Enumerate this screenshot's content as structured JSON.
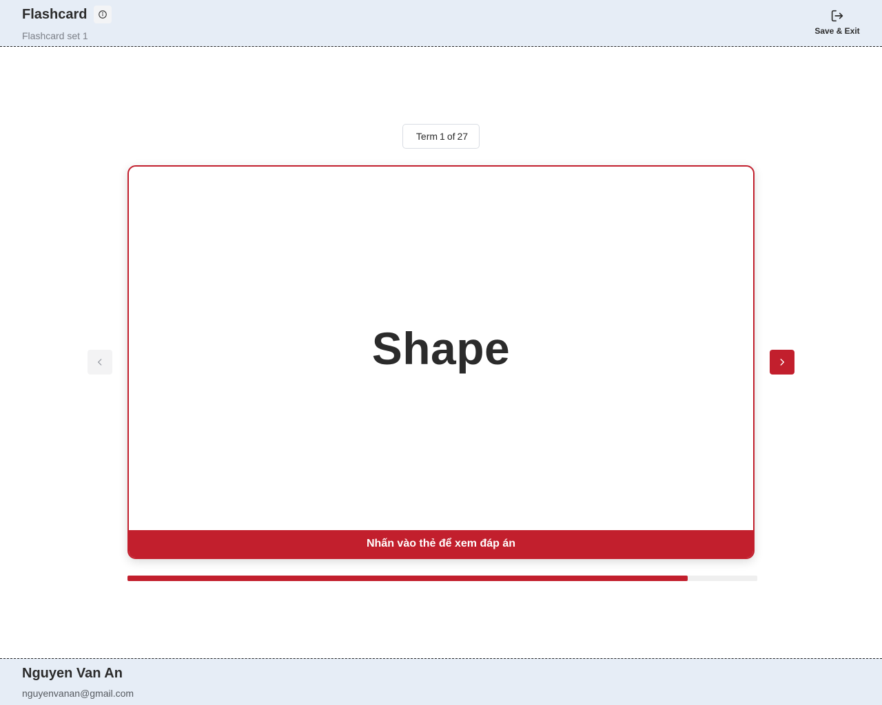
{
  "header": {
    "title": "Flashcard",
    "subtitle": "Flashcard set 1",
    "info_icon": "info-icon",
    "save_exit_label": "Save & Exit",
    "save_exit_icon": "logout-icon"
  },
  "term_badge": {
    "prefix": "Term",
    "current": "1",
    "of": "of",
    "total": "27"
  },
  "card": {
    "term": "Shape",
    "hint": "Nhấn vào thẻ để xem đáp án"
  },
  "navigation": {
    "prev_icon": "chevron-left-icon",
    "next_icon": "chevron-right-icon"
  },
  "progress": {
    "fraction": 0.89
  },
  "user": {
    "name": "Nguyen Van An",
    "email": "nguyenvanan@gmail.com"
  },
  "colors": {
    "accent": "#c21f2d",
    "header_bg": "#e6edf6"
  }
}
